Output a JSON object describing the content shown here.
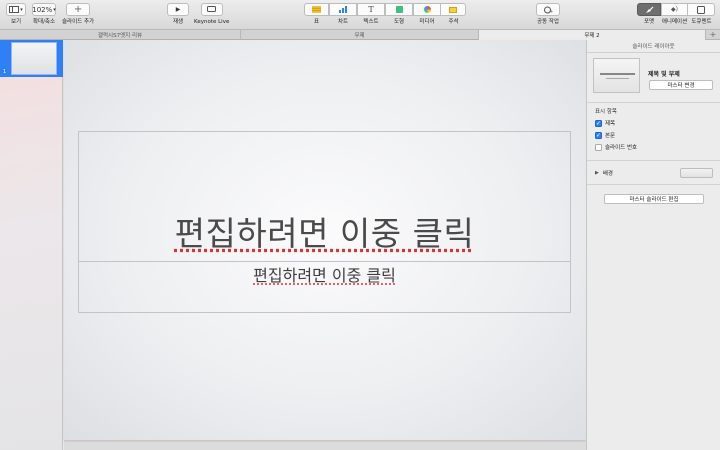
{
  "toolbar": {
    "view_label": "보기",
    "zoom_value": "102%",
    "zoom_label": "확대/축소",
    "add_slide_label": "슬라이드 추가",
    "play_label": "재생",
    "keynote_live_label": "Keynote Live",
    "table_label": "표",
    "chart_label": "차트",
    "text_label": "텍스트",
    "shape_label": "도형",
    "media_label": "미디어",
    "comment_label": "주석",
    "collaborate_label": "공동 작업",
    "format_label": "포맷",
    "animate_label": "애니메이션",
    "document_label": "도큐멘트"
  },
  "tabs": [
    {
      "label": "갤럭시S7엣지 리뷰",
      "active": false
    },
    {
      "label": "무제",
      "active": false
    },
    {
      "label": "무제 2",
      "active": true
    }
  ],
  "navigator": {
    "slides": [
      {
        "number": "1",
        "selected": true
      }
    ]
  },
  "slide": {
    "title_placeholder": "편집하려면 이중 클릭",
    "body_placeholder": "편집하려면 이중 클릭"
  },
  "inspector": {
    "header": "슬라이드 레이아웃",
    "layout_name": "제목 및 부제",
    "change_master_button": "마스터 변경",
    "appearance_title": "표시 항목",
    "options": [
      {
        "label": "제목",
        "checked": true
      },
      {
        "label": "본문",
        "checked": true
      },
      {
        "label": "슬라이드 번호",
        "checked": false
      }
    ],
    "background_label": "배경",
    "edit_master_button": "마스터 슬라이드 편집"
  },
  "colors": {
    "accent": "#2f7ff5",
    "selected_toolbar": "#6e6e6e"
  }
}
